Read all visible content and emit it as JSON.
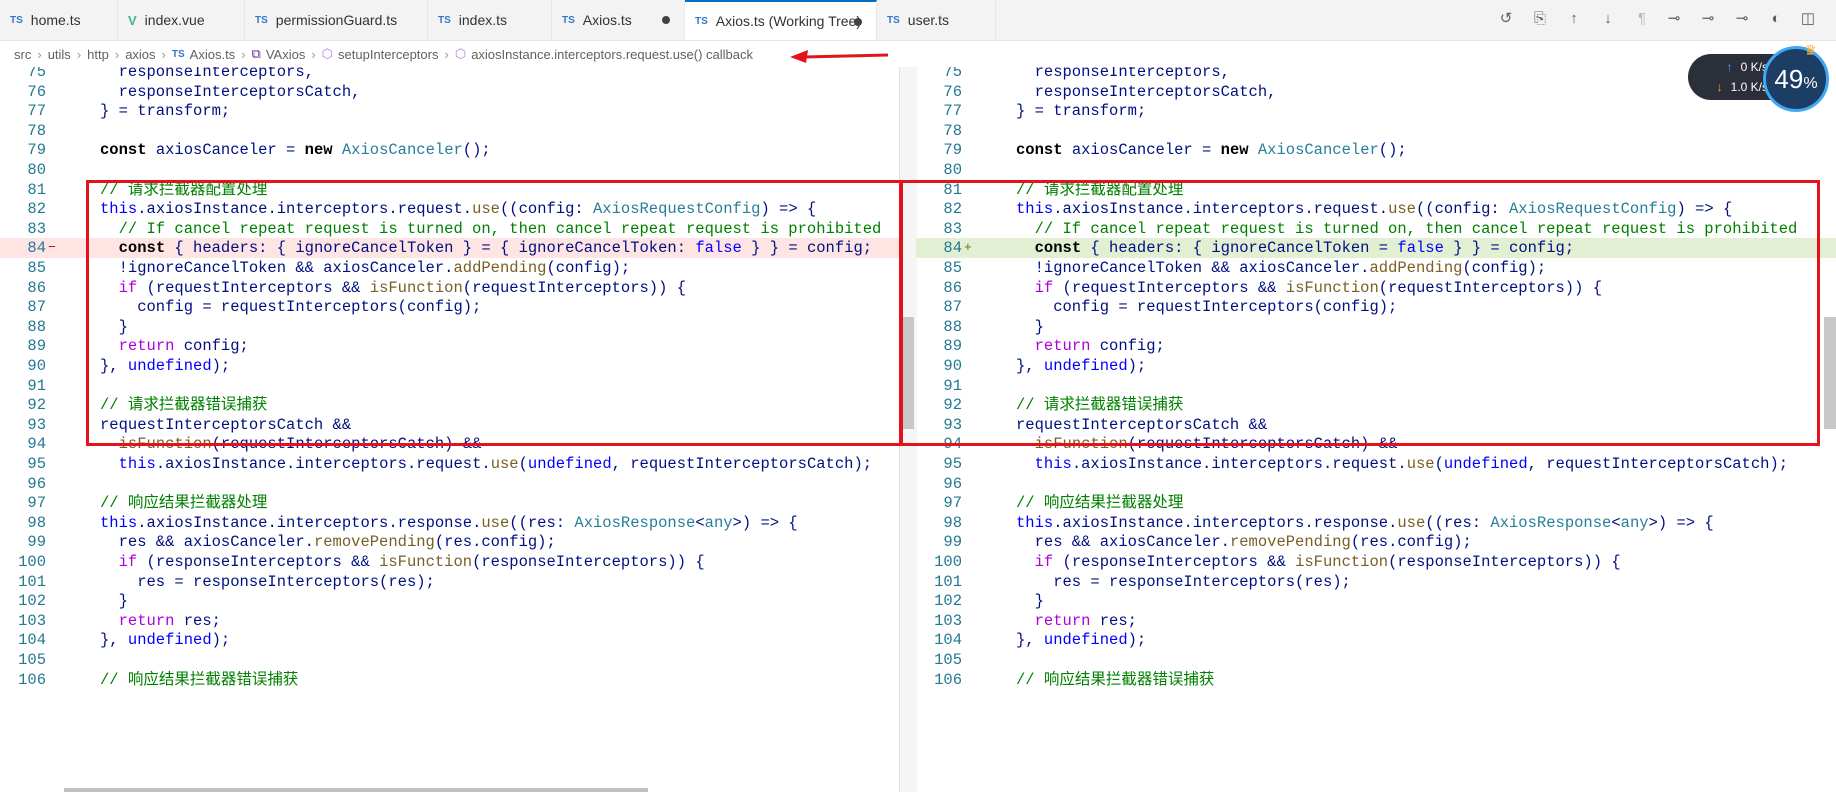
{
  "tabs": [
    {
      "label": "home.ts",
      "icon": "TS"
    },
    {
      "label": "index.vue",
      "icon": "V"
    },
    {
      "label": "permissionGuard.ts",
      "icon": "TS"
    },
    {
      "label": "index.ts",
      "icon": "TS"
    },
    {
      "label": "Axios.ts",
      "icon": "TS"
    },
    {
      "label": "Axios.ts (Working Tree)",
      "icon": "TS"
    },
    {
      "label": "user.ts",
      "icon": "TS"
    }
  ],
  "toolbar_icons": [
    "history-icon",
    "open-file-icon",
    "arrow-up-icon",
    "arrow-down-icon",
    "pilcrow-icon",
    "git-commit-icon",
    "git-commit-icon-2",
    "git-commit-icon-3",
    "compare-icon",
    "split-editor-icon"
  ],
  "breadcrumb": {
    "items": [
      "src",
      "utils",
      "http",
      "axios",
      "Axios.ts",
      "VAxios",
      "setupInterceptors",
      "axiosInstance.interceptors.request.use() callback"
    ],
    "ts_icon": "TS"
  },
  "network_widget": {
    "upload": "0 K/s",
    "download": "1.0 K/s",
    "percent": "49",
    "percent_sign": "%"
  },
  "left_lines": [
    {
      "n": "75",
      "c": "  responseInterceptors,"
    },
    {
      "n": "76",
      "c": "  responseInterceptorsCatch,"
    },
    {
      "n": "77",
      "c": "} = transform;"
    },
    {
      "n": "78",
      "c": ""
    },
    {
      "n": "79",
      "c": "const axiosCanceler = new AxiosCanceler();"
    },
    {
      "n": "80",
      "c": ""
    },
    {
      "n": "81",
      "c": "// 请求拦截器配置处理"
    },
    {
      "n": "82",
      "c": "this.axiosInstance.interceptors.request.use((config: AxiosRequestConfig) => {"
    },
    {
      "n": "83",
      "c": "  // If cancel repeat request is turned on, then cancel repeat request is prohibited"
    },
    {
      "n": "84",
      "c": "  const { headers: { ignoreCancelToken } = { ignoreCancelToken: false } } = config;",
      "mark": "−"
    },
    {
      "n": "85",
      "c": "  !ignoreCancelToken && axiosCanceler.addPending(config);"
    },
    {
      "n": "86",
      "c": "  if (requestInterceptors && isFunction(requestInterceptors)) {"
    },
    {
      "n": "87",
      "c": "    config = requestInterceptors(config);"
    },
    {
      "n": "88",
      "c": "  }"
    },
    {
      "n": "89",
      "c": "  return config;"
    },
    {
      "n": "90",
      "c": "}, undefined);"
    },
    {
      "n": "91",
      "c": ""
    },
    {
      "n": "92",
      "c": "// 请求拦截器错误捕获"
    },
    {
      "n": "93",
      "c": "requestInterceptorsCatch &&"
    },
    {
      "n": "94",
      "c": "  isFunction(requestInterceptorsCatch) &&"
    },
    {
      "n": "95",
      "c": "  this.axiosInstance.interceptors.request.use(undefined, requestInterceptorsCatch);"
    },
    {
      "n": "96",
      "c": ""
    },
    {
      "n": "97",
      "c": "// 响应结果拦截器处理"
    },
    {
      "n": "98",
      "c": "this.axiosInstance.interceptors.response.use((res: AxiosResponse<any>) => {"
    },
    {
      "n": "99",
      "c": "  res && axiosCanceler.removePending(res.config);"
    },
    {
      "n": "100",
      "c": "  if (responseInterceptors && isFunction(responseInterceptors)) {"
    },
    {
      "n": "101",
      "c": "    res = responseInterceptors(res);"
    },
    {
      "n": "102",
      "c": "  }"
    },
    {
      "n": "103",
      "c": "  return res;"
    },
    {
      "n": "104",
      "c": "}, undefined);"
    },
    {
      "n": "105",
      "c": ""
    },
    {
      "n": "106",
      "c": "// 响应结果拦截器错误捕获"
    }
  ],
  "right_lines": [
    {
      "n": "75",
      "c": "  responseInterceptors,"
    },
    {
      "n": "76",
      "c": "  responseInterceptorsCatch,"
    },
    {
      "n": "77",
      "c": "} = transform;"
    },
    {
      "n": "78",
      "c": ""
    },
    {
      "n": "79",
      "c": "const axiosCanceler = new AxiosCanceler();"
    },
    {
      "n": "80",
      "c": ""
    },
    {
      "n": "81",
      "c": "// 请求拦截器配置处理"
    },
    {
      "n": "82",
      "c": "this.axiosInstance.interceptors.request.use((config: AxiosRequestConfig) => {"
    },
    {
      "n": "83",
      "c": "  // If cancel repeat request is turned on, then cancel repeat request is prohibited"
    },
    {
      "n": "84",
      "c": "  const { headers: { ignoreCancelToken = false } } = config;",
      "mark": "+"
    },
    {
      "n": "85",
      "c": "  !ignoreCancelToken && axiosCanceler.addPending(config);"
    },
    {
      "n": "86",
      "c": "  if (requestInterceptors && isFunction(requestInterceptors)) {"
    },
    {
      "n": "87",
      "c": "    config = requestInterceptors(config);"
    },
    {
      "n": "88",
      "c": "  }"
    },
    {
      "n": "89",
      "c": "  return config;"
    },
    {
      "n": "90",
      "c": "}, undefined);"
    },
    {
      "n": "91",
      "c": ""
    },
    {
      "n": "92",
      "c": "// 请求拦截器错误捕获"
    },
    {
      "n": "93",
      "c": "requestInterceptorsCatch &&"
    },
    {
      "n": "94",
      "c": "  isFunction(requestInterceptorsCatch) &&"
    },
    {
      "n": "95",
      "c": "  this.axiosInstance.interceptors.request.use(undefined, requestInterceptorsCatch);"
    },
    {
      "n": "96",
      "c": ""
    },
    {
      "n": "97",
      "c": "// 响应结果拦截器处理"
    },
    {
      "n": "98",
      "c": "this.axiosInstance.interceptors.response.use((res: AxiosResponse<any>) => {"
    },
    {
      "n": "99",
      "c": "  res && axiosCanceler.removePending(res.config);"
    },
    {
      "n": "100",
      "c": "  if (responseInterceptors && isFunction(responseInterceptors)) {"
    },
    {
      "n": "101",
      "c": "    res = responseInterceptors(res);"
    },
    {
      "n": "102",
      "c": "  }"
    },
    {
      "n": "103",
      "c": "  return res;"
    },
    {
      "n": "104",
      "c": "}, undefined);"
    },
    {
      "n": "105",
      "c": ""
    },
    {
      "n": "106",
      "c": "// 响应结果拦截器错误捕获"
    }
  ],
  "colors": {
    "accent": "#0070c1",
    "annotation_red": "#e4131b",
    "deleted_line": "#ffe4e4",
    "inserted_line": "#e2efd3"
  }
}
